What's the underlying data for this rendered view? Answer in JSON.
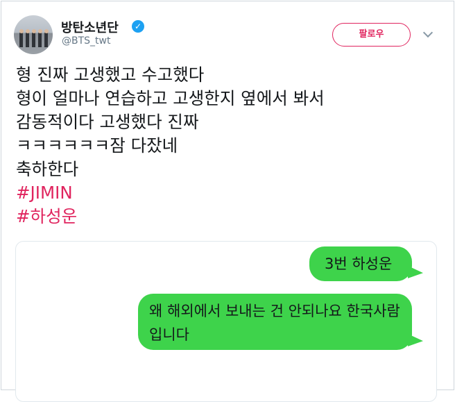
{
  "account": {
    "display_name": "방탄소년단",
    "handle": "@BTS_twt",
    "verified_icon": "verified-badge-icon"
  },
  "actions": {
    "follow_label": "팔로우",
    "more_icon": "chevron-down-icon"
  },
  "tweet": {
    "lines": [
      "형 진짜 고생했고 수고했다",
      "형이 얼마나 연습하고 고생한지 옆에서 봐서",
      "감동적이다 고생했다 진짜",
      "ㅋㅋㅋㅋㅋㅋ잠 다잤네",
      "축하한다"
    ],
    "hashtags": [
      "#JIMIN",
      "#하성운"
    ]
  },
  "media": {
    "messages": [
      "3번 하성운",
      "왜 해외에서 보내는 건 안되나요 한국사람입니다"
    ]
  },
  "colors": {
    "accent": "#e0245e",
    "verified": "#1da1f2",
    "bubble": "#3ed34b",
    "secondary_text": "#657786"
  }
}
